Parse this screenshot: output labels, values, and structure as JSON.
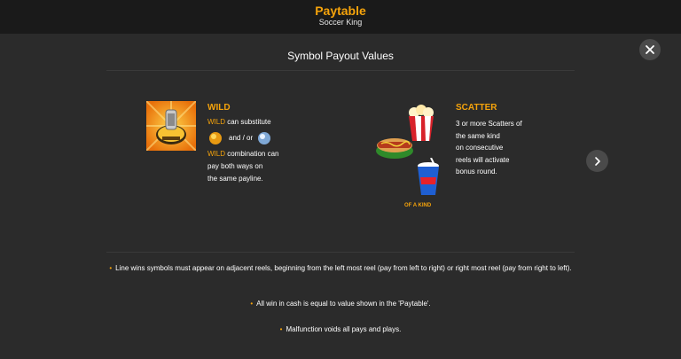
{
  "header": {
    "title": "Paytable",
    "subtitle": "Soccer King"
  },
  "section": {
    "title": "Symbol Payout Values"
  },
  "wild": {
    "title": "WILD",
    "line1_hl": "WILD",
    "line1": " can substitute",
    "and_or": "and / or",
    "line3_hl": "WILD",
    "line3": " combination can",
    "line4": "pay both ways on",
    "line5": "the same payline."
  },
  "scatter": {
    "title": "SCATTER",
    "lines": [
      "3 or more Scatters of",
      "the same kind",
      "on consecutive",
      "reels will activate",
      "bonus round."
    ],
    "of_a_kind": "OF A KIND"
  },
  "rules": [
    "Line wins symbols must appear on adjacent reels, beginning from the left most reel (pay from left to right) or right most reel (pay from right to left).",
    "All win in cash is equal to value shown in the 'Paytable'.",
    "Malfunction voids all pays and plays."
  ],
  "colors": {
    "accent": "#f5a30b",
    "background": "#2b2b2b",
    "header_bg": "#1a1a1a"
  },
  "icons": {
    "close": "close-icon",
    "next": "chevron-right-icon"
  }
}
